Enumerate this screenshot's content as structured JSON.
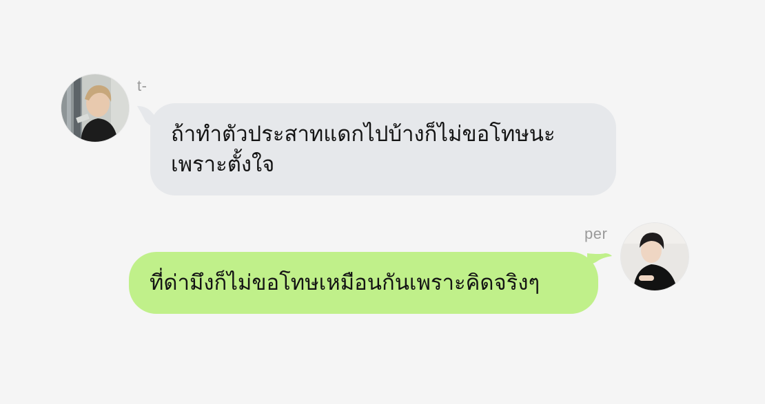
{
  "conversation": {
    "messages": [
      {
        "sender": "t-",
        "side": "left",
        "text": "ถ้าทำตัวประสาทแดกไปบ้างก็ไม่ขอโทษนะ\nเพราะตั้งใจ",
        "bubble_color": "#e6e8eb"
      },
      {
        "sender": "per",
        "side": "right",
        "text": "ที่ด่ามึงก็ไม่ขอโทษเหมือนกันเพราะคิดจริงๆ",
        "bubble_color": "#c0f08a"
      }
    ]
  },
  "colors": {
    "background": "#f5f5f5",
    "name_text": "#9a9a9a",
    "message_text": "#141414"
  },
  "icons": {
    "left_avatar": "avatar-photo",
    "right_avatar": "avatar-photo"
  }
}
